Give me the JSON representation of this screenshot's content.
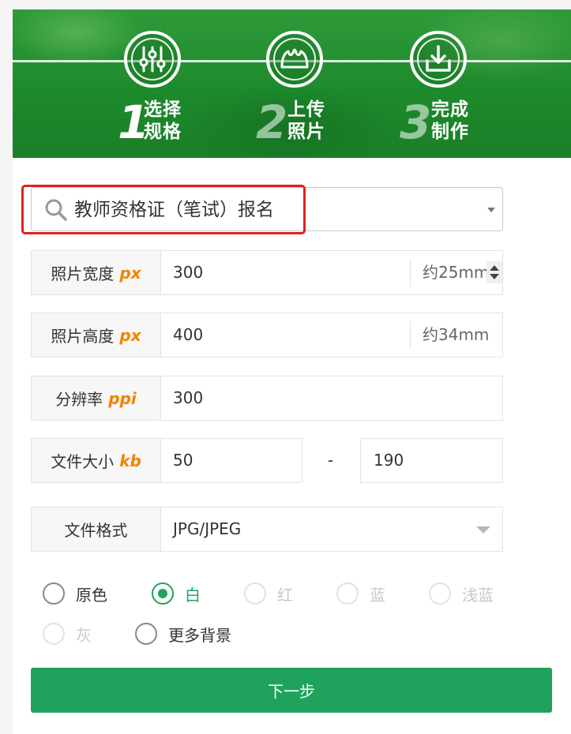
{
  "banner": {
    "steps": [
      {
        "number": "1",
        "line1": "选择",
        "line2": "规格",
        "icon": "sliders-icon"
      },
      {
        "number": "2",
        "line1": "上传",
        "line2": "照片",
        "icon": "upload-photo-icon"
      },
      {
        "number": "3",
        "line1": "完成",
        "line2": "制作",
        "icon": "download-icon"
      }
    ]
  },
  "spec_select": {
    "value": "教师资格证（笔试）报名",
    "icon": "search-icon"
  },
  "fields": {
    "width": {
      "label": "照片宽度",
      "unit": "px",
      "value": "300",
      "suffix": "约25mm"
    },
    "height": {
      "label": "照片高度",
      "unit": "px",
      "value": "400",
      "suffix": "约34mm"
    },
    "dpi": {
      "label": "分辨率",
      "unit": "ppi",
      "value": "300"
    },
    "filesize": {
      "label": "文件大小",
      "unit": "kb",
      "min": "50",
      "separator": "-",
      "max": "190"
    },
    "format": {
      "label": "文件格式",
      "value": "JPG/JPEG"
    }
  },
  "backgrounds": [
    {
      "label": "原色",
      "state": "normal"
    },
    {
      "label": "白",
      "state": "checked"
    },
    {
      "label": "红",
      "state": "disabled"
    },
    {
      "label": "蓝",
      "state": "disabled"
    },
    {
      "label": "浅蓝",
      "state": "disabled"
    },
    {
      "label": "灰",
      "state": "disabled"
    },
    {
      "label": "更多背景",
      "state": "normal"
    }
  ],
  "next_button": {
    "label": "下一步"
  },
  "colors": {
    "primary": "#1fa35c",
    "accent_unit": "#f08300",
    "highlight": "#e02020"
  }
}
